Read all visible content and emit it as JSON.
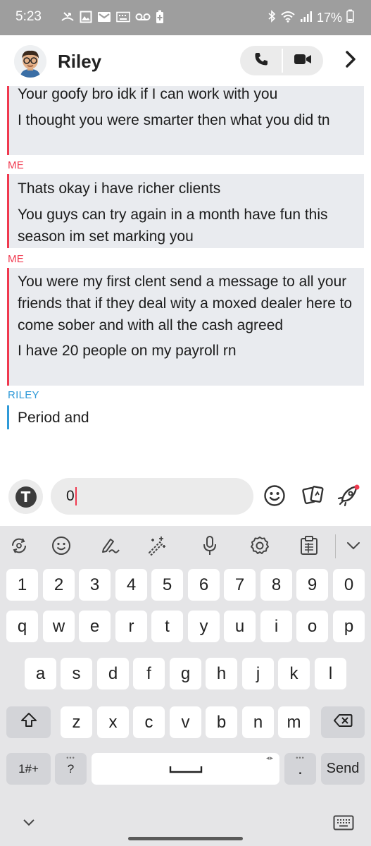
{
  "status_bar": {
    "time": "5:23",
    "battery": "17%",
    "left_icons": [
      "missed-call-icon",
      "image-icon",
      "gmail-icon",
      "keyboard-icon",
      "voicemail-icon",
      "battery-saver-icon"
    ],
    "right_icons": [
      "bluetooth-icon",
      "wifi-icon",
      "signal-icon",
      "battery-icon"
    ]
  },
  "header": {
    "contact_name": "Riley",
    "avatar": "bitmoji-avatar",
    "actions": [
      "phone-icon",
      "video-camera-icon",
      "chevron-right-icon"
    ]
  },
  "chat": {
    "top_block": {
      "messages": [
        "Your goofy bro idk if I can work with you",
        "I thought you were smarter then what you did tn"
      ]
    },
    "block_1": {
      "sender": "ME",
      "messages": [
        "Thats okay i have richer clients",
        "You guys can try again in a month have fun this season im set marking you"
      ]
    },
    "block_2": {
      "sender": "ME",
      "messages": [
        "You were my first clent send a message to all your friends that if they deal wity a moxed dealer here to come sober and with all the cash agreed",
        "I have 20 people on my payroll rn"
      ]
    },
    "block_3": {
      "sender": "RILEY",
      "messages": [
        "Period and"
      ]
    }
  },
  "composer": {
    "input_value": "0",
    "left_button": "T",
    "right_icons": [
      "emoji-icon",
      "cards-icon",
      "rocket-icon"
    ]
  },
  "keyboard": {
    "toolbar_icons": [
      "rotate-icon",
      "emoji-icon",
      "handwriting-icon",
      "magic-wand-icon",
      "microphone-icon",
      "settings-icon",
      "clipboard-icon",
      "chevron-down-icon"
    ],
    "rows": {
      "numbers": [
        "1",
        "2",
        "3",
        "4",
        "5",
        "6",
        "7",
        "8",
        "9",
        "0"
      ],
      "row1": [
        "q",
        "w",
        "e",
        "r",
        "t",
        "y",
        "u",
        "i",
        "o",
        "p"
      ],
      "row2": [
        "a",
        "s",
        "d",
        "f",
        "g",
        "h",
        "j",
        "k",
        "l"
      ],
      "row3": [
        "z",
        "x",
        "c",
        "v",
        "b",
        "n",
        "m"
      ]
    },
    "symbols_key": "1#+",
    "question_key": "?",
    "period_key": ".",
    "send_key": "Send",
    "accent_color": "#f0394f",
    "riley_color": "#2f9ad8"
  }
}
